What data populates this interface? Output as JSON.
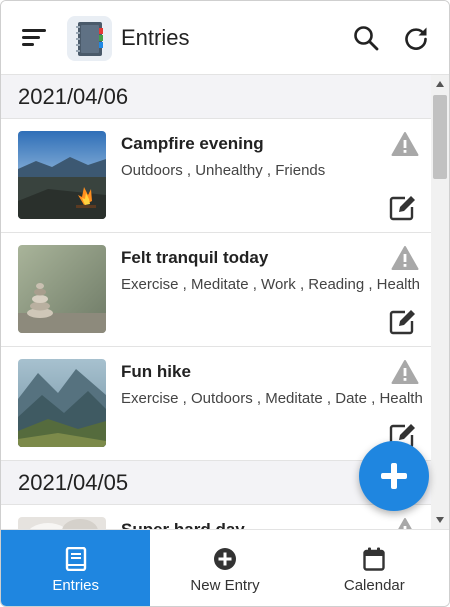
{
  "header": {
    "title": "Entries",
    "menu_icon": "hamburger-menu-icon",
    "logo_icon": "notebook-icon",
    "search_icon": "search-icon",
    "refresh_icon": "refresh-icon"
  },
  "groups": [
    {
      "date": "2021/04/06",
      "entries": [
        {
          "title": "Campfire evening",
          "tags": "Outdoors , Unhealthy , Friends",
          "image": "campfire-photo"
        },
        {
          "title": "Felt tranquil today",
          "tags": "Exercise , Meditate , Work , Reading , Health",
          "image": "stacked-stones-photo"
        },
        {
          "title": "Fun hike",
          "tags": "Exercise , Outdoors , Meditate , Date , Health",
          "image": "mountain-valley-photo"
        }
      ]
    },
    {
      "date": "2021/04/05",
      "entries": [
        {
          "title": "Super hard day",
          "tags": "",
          "image": "white-flower-photo"
        }
      ]
    }
  ],
  "fab": {
    "icon": "plus-icon"
  },
  "bottom_nav": {
    "items": [
      {
        "label": "Entries",
        "icon": "book-icon",
        "active": true
      },
      {
        "label": "New Entry",
        "icon": "plus-circle-icon",
        "active": false
      },
      {
        "label": "Calendar",
        "icon": "calendar-icon",
        "active": false
      }
    ]
  },
  "colors": {
    "accent": "#1f86e0",
    "date_header_bg": "#f3f3f6",
    "icon_gray": "#9e9e9e"
  }
}
